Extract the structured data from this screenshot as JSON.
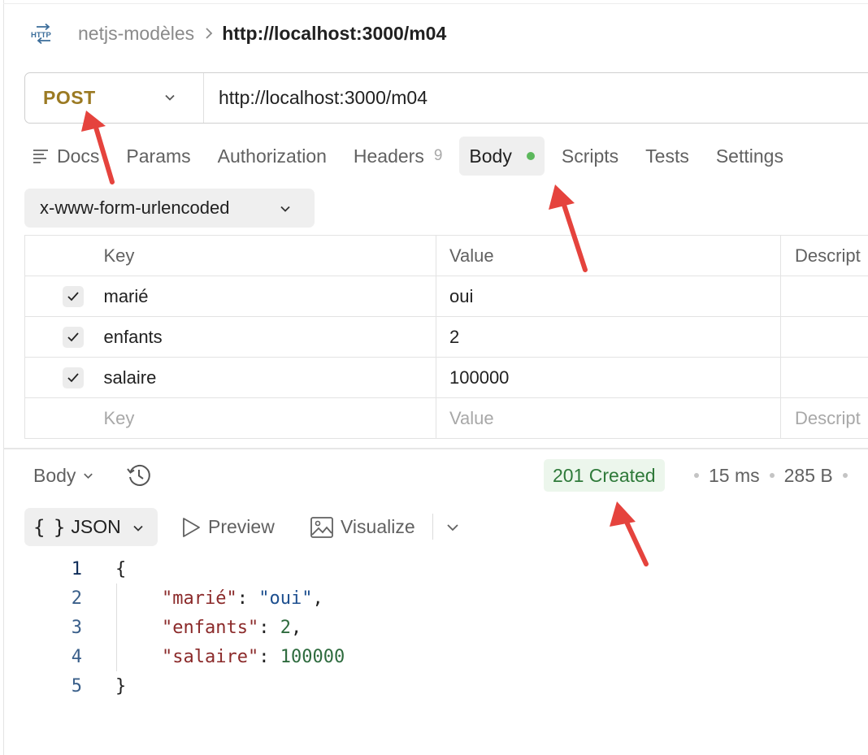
{
  "breadcrumb": {
    "icon": "http-request-icon",
    "collection": "netjs-modèles",
    "current": "http://localhost:3000/m04"
  },
  "request": {
    "method": "POST",
    "url": "http://localhost:3000/m04"
  },
  "tabs": [
    {
      "label": "Docs",
      "icon": "docs-icon"
    },
    {
      "label": "Params"
    },
    {
      "label": "Authorization"
    },
    {
      "label": "Headers",
      "count": "9"
    },
    {
      "label": "Body",
      "active": true,
      "indicator": "green-dot"
    },
    {
      "label": "Scripts"
    },
    {
      "label": "Tests"
    },
    {
      "label": "Settings"
    }
  ],
  "body_type": "x-www-form-urlencoded",
  "params_table": {
    "headers": {
      "key": "Key",
      "value": "Value",
      "description": "Descript"
    },
    "rows": [
      {
        "checked": true,
        "key": "marié",
        "value": "oui"
      },
      {
        "checked": true,
        "key": "enfants",
        "value": "2"
      },
      {
        "checked": true,
        "key": "salaire",
        "value": "100000"
      }
    ],
    "placeholder": {
      "key": "Key",
      "value": "Value",
      "description": "Descript"
    }
  },
  "response": {
    "tab": "Body",
    "status": "201 Created",
    "time": "15 ms",
    "size": "285 B",
    "status_color": "#2f7a3a",
    "formats": {
      "selected": "JSON",
      "preview": "Preview",
      "visualize": "Visualize"
    },
    "code": {
      "line_numbers": [
        "1",
        "2",
        "3",
        "4",
        "5"
      ],
      "open": "{",
      "lines": [
        {
          "key": "\"marié\"",
          "value": "\"oui\"",
          "value_type": "string",
          "trail": ","
        },
        {
          "key": "\"enfants\"",
          "value": "2",
          "value_type": "number",
          "trail": ","
        },
        {
          "key": "\"salaire\"",
          "value": "100000",
          "value_type": "number",
          "trail": ""
        }
      ],
      "close": "}"
    }
  },
  "colors": {
    "method": "#9b7a23",
    "annotation_arrow": "#e5433d"
  }
}
